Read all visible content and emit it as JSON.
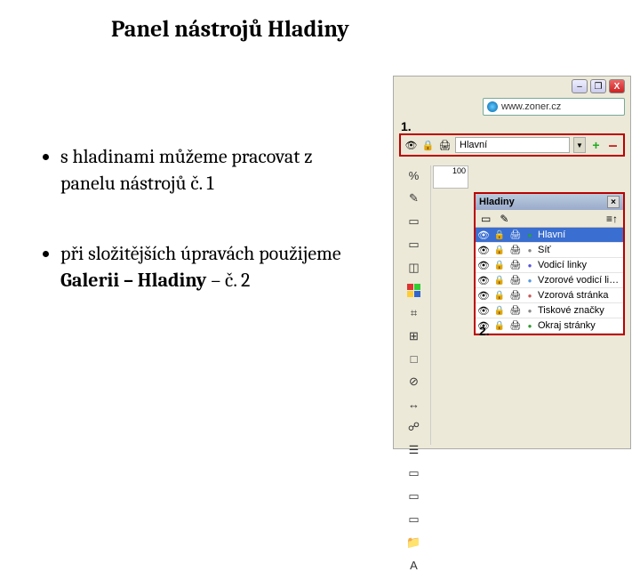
{
  "title": "Panel nástrojů Hladiny",
  "bullets": {
    "b1": "s hladinami můžeme pracovat z panelu nástrojů č. 1",
    "b2_a": "při složitějších úpravách použijeme ",
    "b2_b": "Galerii – Hladiny",
    "b2_c": " – č. 2"
  },
  "labels": {
    "n1": "1.",
    "n2": "2."
  },
  "url": "www.zoner.cz",
  "area1": {
    "layer": "Hlavní"
  },
  "panel": {
    "title": "Hladiny",
    "rows": [
      {
        "name": "Hlavní",
        "selected": true,
        "color": "#2a2"
      },
      {
        "name": "Síť",
        "selected": false,
        "color": "#888"
      },
      {
        "name": "Vodicí linky",
        "selected": false,
        "color": "#55d"
      },
      {
        "name": "Vzorové vodicí linky",
        "selected": false,
        "color": "#59d"
      },
      {
        "name": "Vzorová stránka",
        "selected": false,
        "color": "#c55"
      },
      {
        "name": "Tiskové značky",
        "selected": false,
        "color": "#888"
      },
      {
        "name": "Okraj stránky",
        "selected": false,
        "color": "#393"
      }
    ]
  },
  "vtool_icons": [
    "%",
    "✎",
    "▭",
    "▭",
    "◫",
    "",
    "⌗",
    "⊞",
    "□",
    "⊘",
    "↔",
    "☍",
    "☰",
    "▭",
    "▭",
    "▭",
    "📁",
    "A"
  ],
  "ruler": "100",
  "winbtns": {
    "min": "–",
    "max": "❐",
    "close": "X"
  }
}
